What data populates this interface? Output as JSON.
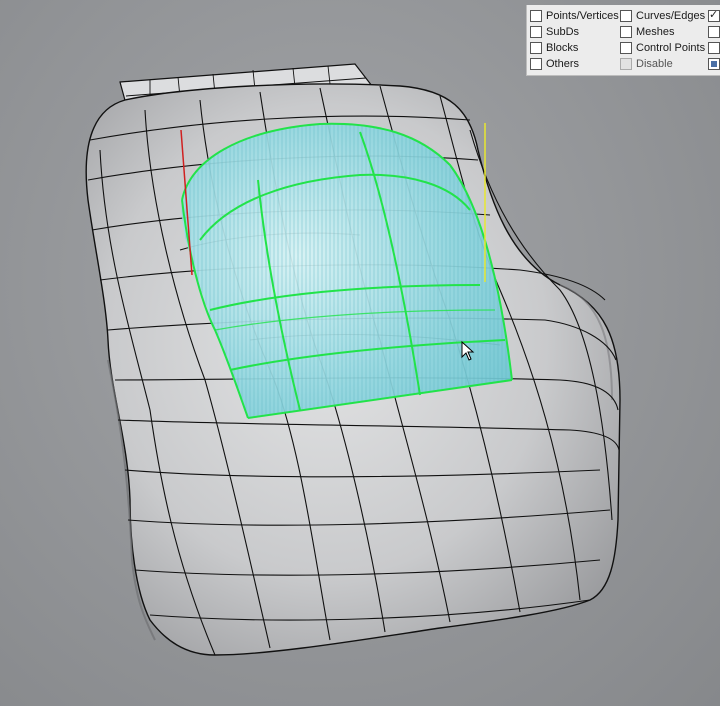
{
  "osnap_panel": {
    "options": [
      {
        "key": "points_vertices",
        "label": "Points/Vertices",
        "checked": false
      },
      {
        "key": "curves_edges",
        "label": "Curves/Edges",
        "checked": false
      },
      {
        "key": "extra_top",
        "label": "",
        "checked": true
      },
      {
        "key": "subds",
        "label": "SubDs",
        "checked": false
      },
      {
        "key": "meshes",
        "label": "Meshes",
        "checked": false
      },
      {
        "key": "extra_meshes",
        "label": "",
        "checked": false
      },
      {
        "key": "blocks",
        "label": "Blocks",
        "checked": false
      },
      {
        "key": "control_points",
        "label": "Control Points",
        "checked": false
      },
      {
        "key": "extra_cp",
        "label": "",
        "checked": false
      },
      {
        "key": "others",
        "label": "Others",
        "checked": false
      },
      {
        "key": "disable",
        "label": "Disable",
        "checked": false
      },
      {
        "key": "extra_disable",
        "label": "",
        "indeterminate": true
      }
    ]
  },
  "viewport": {
    "colors": {
      "background": "#93959a",
      "model_surface": "#c9cacc",
      "wire": "#111111",
      "selected_edges": "#22e34a",
      "selected_fill": "#7fd8e0",
      "axis_x": "#d02020",
      "axis_y": "#e8e830"
    },
    "cursor_icon": "arrow-pointer-icon"
  }
}
